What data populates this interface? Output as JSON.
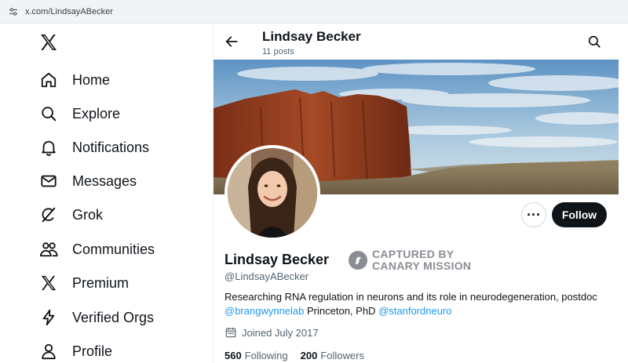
{
  "browser": {
    "url": "x.com/LindsayABecker",
    "site_icon": "tune-icon"
  },
  "sidebar": {
    "logo": "x-logo",
    "items": [
      {
        "label": "Home",
        "icon": "home-icon"
      },
      {
        "label": "Explore",
        "icon": "search-icon"
      },
      {
        "label": "Notifications",
        "icon": "bell-icon"
      },
      {
        "label": "Messages",
        "icon": "envelope-icon"
      },
      {
        "label": "Grok",
        "icon": "grok-icon"
      },
      {
        "label": "Communities",
        "icon": "people-icon"
      },
      {
        "label": "Premium",
        "icon": "x-logo-icon"
      },
      {
        "label": "Verified Orgs",
        "icon": "lightning-icon"
      },
      {
        "label": "Profile",
        "icon": "person-icon"
      }
    ]
  },
  "header": {
    "name": "Lindsay Becker",
    "posts_count": "11 posts"
  },
  "profile": {
    "display_name": "Lindsay Becker",
    "handle": "@LindsayABecker",
    "follow_label": "Follow",
    "more_label": "···",
    "bio_text": "Researching RNA regulation in neurons and its role in neurodegeneration, postdoc",
    "bio_link_1": "@brangwynnelab",
    "bio_middle": "Princeton, PhD",
    "bio_link_2": "@stanfordneuro",
    "joined": "Joined July 2017",
    "following_count": "560",
    "following_label": "Following",
    "followers_count": "200",
    "followers_label": "Followers"
  },
  "watermark": {
    "line1": "CAPTURED BY",
    "line2": "CANARY MISSION"
  },
  "colors": {
    "text": "#0f1419",
    "secondary": "#536471",
    "link": "#1d9bf0",
    "follow_bg": "#0f1419",
    "watermark": "#8a8e93"
  }
}
